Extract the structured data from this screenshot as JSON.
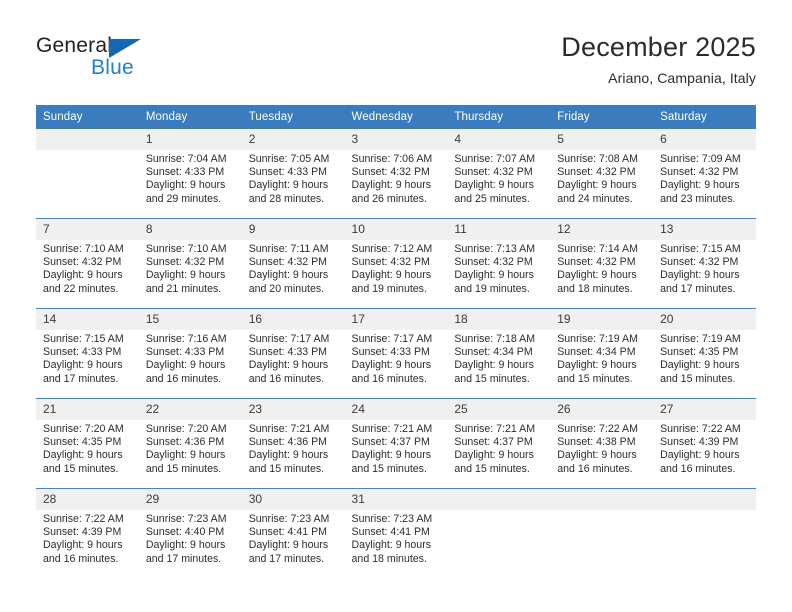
{
  "brand": {
    "name_part1": "General",
    "name_part2": "Blue",
    "triangle_color": "#1567b2",
    "blue_color": "#1f7fd0"
  },
  "header": {
    "title": "December 2025",
    "subtitle": "Ariano, Campania, Italy"
  },
  "theme": {
    "header_row_bg": "#3a7cbe",
    "header_row_text": "#ffffff",
    "daynum_bg": "#f0f0f0",
    "row_divider": "#4a84c0"
  },
  "weekday_headers": [
    "Sunday",
    "Monday",
    "Tuesday",
    "Wednesday",
    "Thursday",
    "Friday",
    "Saturday"
  ],
  "weeks": [
    [
      {
        "day": "",
        "empty": true,
        "sunrise": "",
        "sunset": "",
        "daylight_line1": "",
        "daylight_line2": ""
      },
      {
        "day": "1",
        "sunrise": "Sunrise: 7:04 AM",
        "sunset": "Sunset: 4:33 PM",
        "daylight_line1": "Daylight: 9 hours",
        "daylight_line2": "and 29 minutes."
      },
      {
        "day": "2",
        "sunrise": "Sunrise: 7:05 AM",
        "sunset": "Sunset: 4:33 PM",
        "daylight_line1": "Daylight: 9 hours",
        "daylight_line2": "and 28 minutes."
      },
      {
        "day": "3",
        "sunrise": "Sunrise: 7:06 AM",
        "sunset": "Sunset: 4:32 PM",
        "daylight_line1": "Daylight: 9 hours",
        "daylight_line2": "and 26 minutes."
      },
      {
        "day": "4",
        "sunrise": "Sunrise: 7:07 AM",
        "sunset": "Sunset: 4:32 PM",
        "daylight_line1": "Daylight: 9 hours",
        "daylight_line2": "and 25 minutes."
      },
      {
        "day": "5",
        "sunrise": "Sunrise: 7:08 AM",
        "sunset": "Sunset: 4:32 PM",
        "daylight_line1": "Daylight: 9 hours",
        "daylight_line2": "and 24 minutes."
      },
      {
        "day": "6",
        "sunrise": "Sunrise: 7:09 AM",
        "sunset": "Sunset: 4:32 PM",
        "daylight_line1": "Daylight: 9 hours",
        "daylight_line2": "and 23 minutes."
      }
    ],
    [
      {
        "day": "7",
        "sunrise": "Sunrise: 7:10 AM",
        "sunset": "Sunset: 4:32 PM",
        "daylight_line1": "Daylight: 9 hours",
        "daylight_line2": "and 22 minutes."
      },
      {
        "day": "8",
        "sunrise": "Sunrise: 7:10 AM",
        "sunset": "Sunset: 4:32 PM",
        "daylight_line1": "Daylight: 9 hours",
        "daylight_line2": "and 21 minutes."
      },
      {
        "day": "9",
        "sunrise": "Sunrise: 7:11 AM",
        "sunset": "Sunset: 4:32 PM",
        "daylight_line1": "Daylight: 9 hours",
        "daylight_line2": "and 20 minutes."
      },
      {
        "day": "10",
        "sunrise": "Sunrise: 7:12 AM",
        "sunset": "Sunset: 4:32 PM",
        "daylight_line1": "Daylight: 9 hours",
        "daylight_line2": "and 19 minutes."
      },
      {
        "day": "11",
        "sunrise": "Sunrise: 7:13 AM",
        "sunset": "Sunset: 4:32 PM",
        "daylight_line1": "Daylight: 9 hours",
        "daylight_line2": "and 19 minutes."
      },
      {
        "day": "12",
        "sunrise": "Sunrise: 7:14 AM",
        "sunset": "Sunset: 4:32 PM",
        "daylight_line1": "Daylight: 9 hours",
        "daylight_line2": "and 18 minutes."
      },
      {
        "day": "13",
        "sunrise": "Sunrise: 7:15 AM",
        "sunset": "Sunset: 4:32 PM",
        "daylight_line1": "Daylight: 9 hours",
        "daylight_line2": "and 17 minutes."
      }
    ],
    [
      {
        "day": "14",
        "sunrise": "Sunrise: 7:15 AM",
        "sunset": "Sunset: 4:33 PM",
        "daylight_line1": "Daylight: 9 hours",
        "daylight_line2": "and 17 minutes."
      },
      {
        "day": "15",
        "sunrise": "Sunrise: 7:16 AM",
        "sunset": "Sunset: 4:33 PM",
        "daylight_line1": "Daylight: 9 hours",
        "daylight_line2": "and 16 minutes."
      },
      {
        "day": "16",
        "sunrise": "Sunrise: 7:17 AM",
        "sunset": "Sunset: 4:33 PM",
        "daylight_line1": "Daylight: 9 hours",
        "daylight_line2": "and 16 minutes."
      },
      {
        "day": "17",
        "sunrise": "Sunrise: 7:17 AM",
        "sunset": "Sunset: 4:33 PM",
        "daylight_line1": "Daylight: 9 hours",
        "daylight_line2": "and 16 minutes."
      },
      {
        "day": "18",
        "sunrise": "Sunrise: 7:18 AM",
        "sunset": "Sunset: 4:34 PM",
        "daylight_line1": "Daylight: 9 hours",
        "daylight_line2": "and 15 minutes."
      },
      {
        "day": "19",
        "sunrise": "Sunrise: 7:19 AM",
        "sunset": "Sunset: 4:34 PM",
        "daylight_line1": "Daylight: 9 hours",
        "daylight_line2": "and 15 minutes."
      },
      {
        "day": "20",
        "sunrise": "Sunrise: 7:19 AM",
        "sunset": "Sunset: 4:35 PM",
        "daylight_line1": "Daylight: 9 hours",
        "daylight_line2": "and 15 minutes."
      }
    ],
    [
      {
        "day": "21",
        "sunrise": "Sunrise: 7:20 AM",
        "sunset": "Sunset: 4:35 PM",
        "daylight_line1": "Daylight: 9 hours",
        "daylight_line2": "and 15 minutes."
      },
      {
        "day": "22",
        "sunrise": "Sunrise: 7:20 AM",
        "sunset": "Sunset: 4:36 PM",
        "daylight_line1": "Daylight: 9 hours",
        "daylight_line2": "and 15 minutes."
      },
      {
        "day": "23",
        "sunrise": "Sunrise: 7:21 AM",
        "sunset": "Sunset: 4:36 PM",
        "daylight_line1": "Daylight: 9 hours",
        "daylight_line2": "and 15 minutes."
      },
      {
        "day": "24",
        "sunrise": "Sunrise: 7:21 AM",
        "sunset": "Sunset: 4:37 PM",
        "daylight_line1": "Daylight: 9 hours",
        "daylight_line2": "and 15 minutes."
      },
      {
        "day": "25",
        "sunrise": "Sunrise: 7:21 AM",
        "sunset": "Sunset: 4:37 PM",
        "daylight_line1": "Daylight: 9 hours",
        "daylight_line2": "and 15 minutes."
      },
      {
        "day": "26",
        "sunrise": "Sunrise: 7:22 AM",
        "sunset": "Sunset: 4:38 PM",
        "daylight_line1": "Daylight: 9 hours",
        "daylight_line2": "and 16 minutes."
      },
      {
        "day": "27",
        "sunrise": "Sunrise: 7:22 AM",
        "sunset": "Sunset: 4:39 PM",
        "daylight_line1": "Daylight: 9 hours",
        "daylight_line2": "and 16 minutes."
      }
    ],
    [
      {
        "day": "28",
        "sunrise": "Sunrise: 7:22 AM",
        "sunset": "Sunset: 4:39 PM",
        "daylight_line1": "Daylight: 9 hours",
        "daylight_line2": "and 16 minutes."
      },
      {
        "day": "29",
        "sunrise": "Sunrise: 7:23 AM",
        "sunset": "Sunset: 4:40 PM",
        "daylight_line1": "Daylight: 9 hours",
        "daylight_line2": "and 17 minutes."
      },
      {
        "day": "30",
        "sunrise": "Sunrise: 7:23 AM",
        "sunset": "Sunset: 4:41 PM",
        "daylight_line1": "Daylight: 9 hours",
        "daylight_line2": "and 17 minutes."
      },
      {
        "day": "31",
        "sunrise": "Sunrise: 7:23 AM",
        "sunset": "Sunset: 4:41 PM",
        "daylight_line1": "Daylight: 9 hours",
        "daylight_line2": "and 18 minutes."
      },
      {
        "day": "",
        "empty": true,
        "sunrise": "",
        "sunset": "",
        "daylight_line1": "",
        "daylight_line2": ""
      },
      {
        "day": "",
        "empty": true,
        "sunrise": "",
        "sunset": "",
        "daylight_line1": "",
        "daylight_line2": ""
      },
      {
        "day": "",
        "empty": true,
        "sunrise": "",
        "sunset": "",
        "daylight_line1": "",
        "daylight_line2": ""
      }
    ]
  ]
}
